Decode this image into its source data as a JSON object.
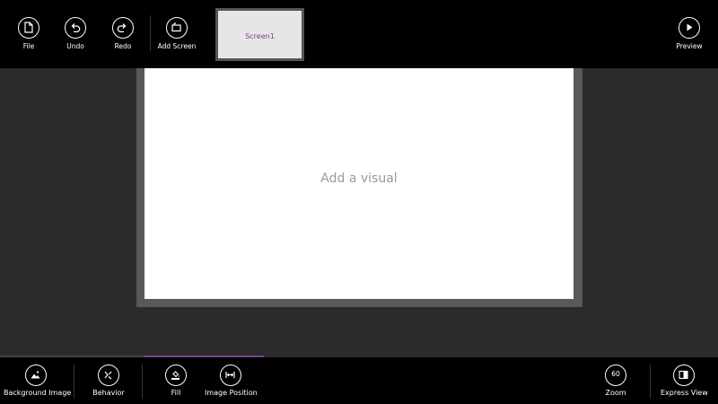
{
  "topbar": {
    "file_label": "File",
    "undo_label": "Undo",
    "redo_label": "Redo",
    "add_screen_label": "Add Screen",
    "preview_label": "Preview",
    "screens": [
      {
        "label": "Screen1"
      }
    ]
  },
  "canvas": {
    "placeholder": "Add a visual"
  },
  "bottombar": {
    "background_image_label": "Background Image",
    "behavior_label": "Behavior",
    "fill_label": "Fill",
    "image_position_label": "Image Position",
    "zoom_label": "Zoom",
    "zoom_value": "60",
    "express_view_label": "Express View"
  },
  "colors": {
    "accent": "#7a3f8c",
    "bar": "#000000",
    "workspace": "#2b2b2b",
    "tab_inactive": "#444444"
  },
  "icons": [
    "file-icon",
    "undo-icon",
    "redo-icon",
    "add-screen-icon",
    "play-icon",
    "background-image-icon",
    "behavior-icon",
    "fill-icon",
    "image-position-icon",
    "express-view-icon"
  ]
}
